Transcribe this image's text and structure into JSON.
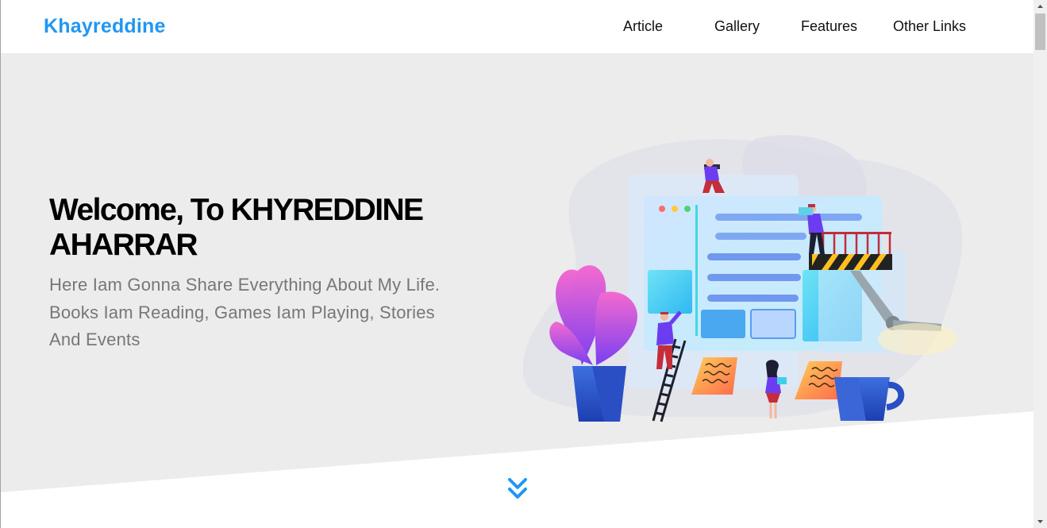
{
  "header": {
    "logo": "Khayreddine",
    "nav": [
      {
        "label": "Article"
      },
      {
        "label": "Gallery"
      },
      {
        "label": "Features"
      },
      {
        "label": "Other Links"
      }
    ]
  },
  "hero": {
    "title": "Welcome, To KHYREDDINE AHARRAR",
    "text": "Here Iam Gonna Share Everything About My Life. Books Iam Reading, Games Iam Playing, Stories And Events",
    "scroll_icon": "double-chevron-down-icon"
  },
  "colors": {
    "accent": "#2196f3",
    "hero_bg": "#ececec",
    "text_muted": "#777777"
  },
  "scrollbar": {
    "up_icon": "triangle-up-icon",
    "down_icon": "triangle-down-icon"
  }
}
